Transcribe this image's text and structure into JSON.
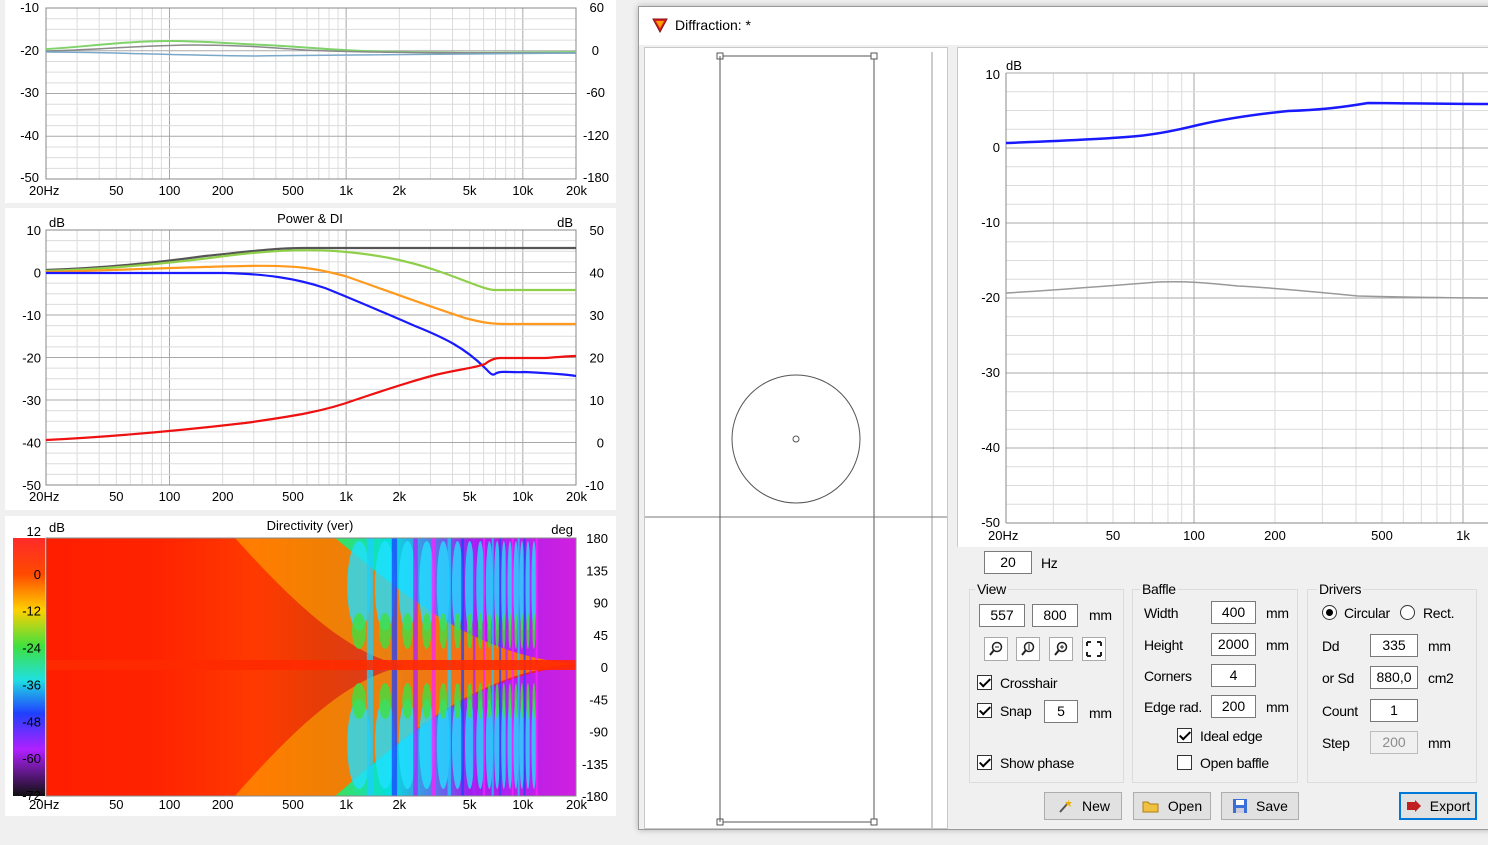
{
  "colors": {
    "green": "#8fcf4a",
    "orange": "#ff9a1e",
    "blue": "#1a1aff",
    "red": "#ee1111",
    "gray": "#999999",
    "dark": "#555555"
  },
  "left_charts": {
    "top": {
      "y_left": [
        "-10",
        "-20",
        "-30",
        "-40",
        "-50"
      ],
      "y_right": [
        "60",
        "0",
        "-60",
        "-120",
        "-180"
      ],
      "x_ticks": [
        "20Hz",
        "50",
        "100",
        "200",
        "500",
        "1k",
        "2k",
        "5k",
        "10k",
        "20k"
      ]
    },
    "power": {
      "title": "Power & DI",
      "y_left_unit": "dB",
      "y_right_unit": "dB",
      "y_left": [
        "10",
        "0",
        "-10",
        "-20",
        "-30",
        "-40",
        "-50"
      ],
      "y_right": [
        "50",
        "40",
        "30",
        "20",
        "10",
        "0",
        "-10"
      ],
      "x_ticks": [
        "20Hz",
        "50",
        "100",
        "200",
        "500",
        "1k",
        "2k",
        "5k",
        "10k",
        "20k"
      ]
    },
    "directivity": {
      "title": "Directivity (ver)",
      "y_left_unit": "dB",
      "y_right_unit": "deg",
      "scale": [
        "12",
        "0",
        "-12",
        "-24",
        "-36",
        "-48",
        "-60",
        "-72"
      ],
      "y_right": [
        "180",
        "135",
        "90",
        "45",
        "0",
        "-45",
        "-90",
        "-135",
        "-180"
      ],
      "x_ticks": [
        "20Hz",
        "50",
        "100",
        "200",
        "500",
        "1k",
        "2k",
        "5k",
        "10k",
        "20k"
      ]
    }
  },
  "window": {
    "title": "Diffraction: *",
    "graph": {
      "unit": "dB",
      "y_ticks": [
        "10",
        "0",
        "-10",
        "-20",
        "-30",
        "-40",
        "-50"
      ],
      "x_ticks": [
        "20Hz",
        "50",
        "100",
        "200",
        "500",
        "1k"
      ]
    },
    "freq": {
      "value": "20",
      "unit": "Hz"
    },
    "view": {
      "label": "View",
      "x": "557",
      "y": "800",
      "unit": "mm",
      "crosshair_label": "Crosshair",
      "crosshair": true,
      "snap_label": "Snap",
      "snap": true,
      "snap_value": "5",
      "snap_unit": "mm",
      "show_phase_label": "Show phase",
      "show_phase": true
    },
    "baffle": {
      "label": "Baffle",
      "width_label": "Width",
      "width": "400",
      "width_unit": "mm",
      "height_label": "Height",
      "height": "2000",
      "height_unit": "mm",
      "corners_label": "Corners",
      "corners": "4",
      "edge_label": "Edge rad.",
      "edge": "200",
      "edge_unit": "mm",
      "ideal_edge_label": "Ideal edge",
      "ideal_edge": true,
      "open_baffle_label": "Open baffle",
      "open_baffle": false
    },
    "drivers": {
      "label": "Drivers",
      "circular_label": "Circular",
      "rect_label": "Rect.",
      "shape": "circular",
      "dd_label": "Dd",
      "dd": "335",
      "dd_unit": "mm",
      "sd_label": "or Sd",
      "sd": "880,0",
      "sd_unit": "cm2",
      "count_label": "Count",
      "count": "1",
      "step_label": "Step",
      "step": "200",
      "step_unit": "mm"
    },
    "buttons": {
      "new": "New",
      "open": "Open",
      "save": "Save",
      "export": "Export"
    }
  }
}
